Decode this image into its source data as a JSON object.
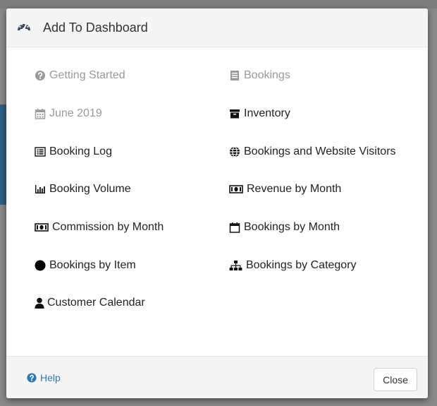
{
  "modal": {
    "title": "Add To Dashboard",
    "title_icon": "dashboard-icon"
  },
  "items": [
    {
      "id": "getting-started",
      "label": "Getting Started",
      "icon": "question-circle-icon",
      "enabled": false
    },
    {
      "id": "bookings",
      "label": "Bookings",
      "icon": "book-icon",
      "enabled": false
    },
    {
      "id": "june-2019",
      "label": "June 2019",
      "icon": "calendar-grid-icon",
      "enabled": false
    },
    {
      "id": "inventory",
      "label": "Inventory",
      "icon": "archive-icon",
      "enabled": true
    },
    {
      "id": "booking-log",
      "label": "Booking Log",
      "icon": "list-alt-icon",
      "enabled": true
    },
    {
      "id": "bookings-website-visitors",
      "label": "Bookings and Website Visitors",
      "icon": "globe-icon",
      "enabled": true
    },
    {
      "id": "booking-volume",
      "label": "Booking Volume",
      "icon": "bar-chart-icon",
      "enabled": true
    },
    {
      "id": "revenue-by-month",
      "label": "Revenue by Month",
      "icon": "money-icon",
      "enabled": true
    },
    {
      "id": "commission-by-month",
      "label": "Commission by Month",
      "icon": "money-icon",
      "enabled": true
    },
    {
      "id": "bookings-by-month",
      "label": "Bookings by Month",
      "icon": "calendar-icon",
      "enabled": true
    },
    {
      "id": "bookings-by-item",
      "label": "Bookings by Item",
      "icon": "circle-icon",
      "enabled": true
    },
    {
      "id": "bookings-by-category",
      "label": "Bookings by Category",
      "icon": "sitemap-icon",
      "enabled": true
    },
    {
      "id": "customer-calendar",
      "label": "Customer Calendar",
      "icon": "user-icon",
      "enabled": true
    }
  ],
  "footer": {
    "help_label": "Help",
    "close_label": "Close"
  },
  "colors": {
    "link": "#2a7ab7",
    "disabled_text": "#9a9a9a",
    "text": "#222222"
  }
}
